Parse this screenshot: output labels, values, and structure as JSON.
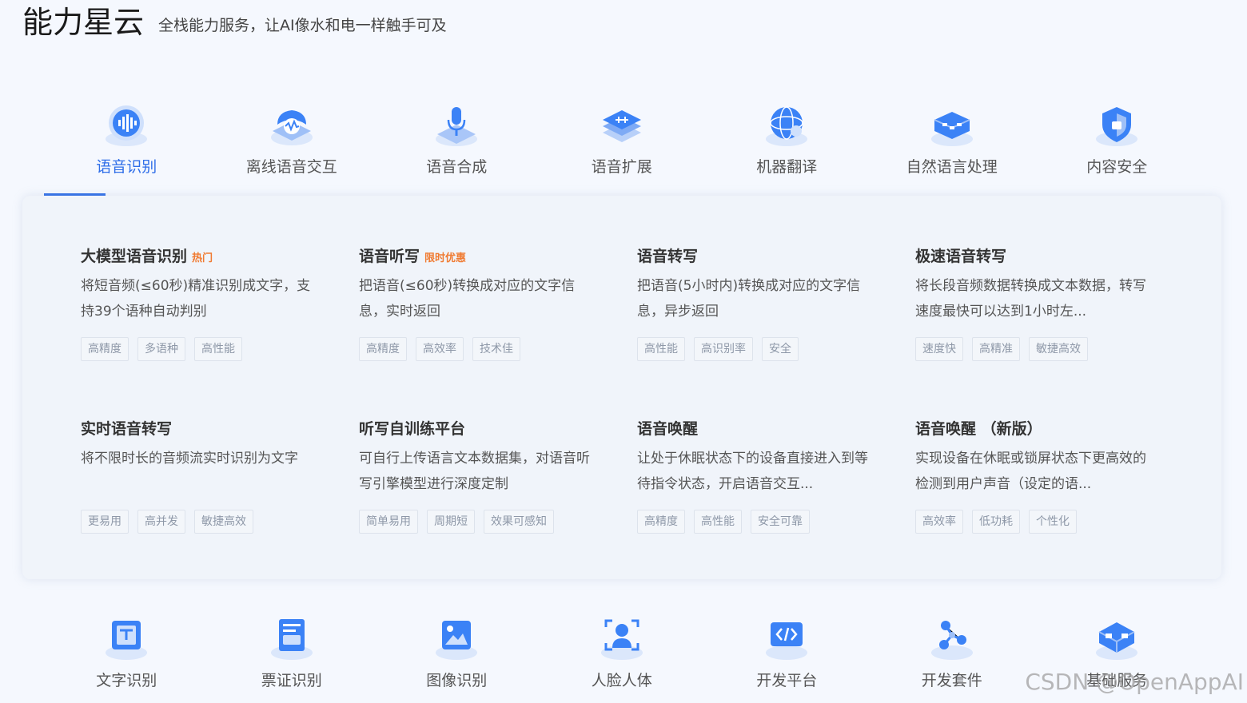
{
  "header": {
    "title": "能力星云",
    "subtitle": "全栈能力服务，让AI像水和电一样触手可及"
  },
  "tabs": [
    {
      "label": "语音识别",
      "icon": "voice-recognition-icon"
    },
    {
      "label": "离线语音交互",
      "icon": "offline-voice-icon"
    },
    {
      "label": "语音合成",
      "icon": "microphone-icon"
    },
    {
      "label": "语音扩展",
      "icon": "voice-extension-icon"
    },
    {
      "label": "机器翻译",
      "icon": "globe-icon"
    },
    {
      "label": "自然语言处理",
      "icon": "nlp-icon"
    },
    {
      "label": "内容安全",
      "icon": "shield-icon"
    }
  ],
  "active_tab": "语音识别",
  "cards": [
    {
      "title": "大模型语音识别",
      "badge": "热门",
      "desc": "将短音频(≤60秒)精准识别成文字，支持39个语种自动判别",
      "tags": [
        "高精度",
        "多语种",
        "高性能"
      ]
    },
    {
      "title": "语音听写",
      "badge": "限时优惠",
      "desc": "把语音(≤60秒)转换成对应的文字信息，实时返回",
      "tags": [
        "高精度",
        "高效率",
        "技术佳"
      ]
    },
    {
      "title": "语音转写",
      "badge": "",
      "desc": "把语音(5小时内)转换成对应的文字信息，异步返回",
      "tags": [
        "高性能",
        "高识别率",
        "安全"
      ]
    },
    {
      "title": "极速语音转写",
      "badge": "",
      "desc": "将长段音频数据转换成文本数据，转写速度最快可以达到1小时左...",
      "tags": [
        "速度快",
        "高精准",
        "敏捷高效"
      ]
    },
    {
      "title": "实时语音转写",
      "badge": "",
      "desc": "将不限时长的音频流实时识别为文字",
      "tags": [
        "更易用",
        "高并发",
        "敏捷高效"
      ]
    },
    {
      "title": "听写自训练平台",
      "badge": "",
      "desc": "可自行上传语言文本数据集，对语音听写引擎模型进行深度定制",
      "tags": [
        "简单易用",
        "周期短",
        "效果可感知"
      ]
    },
    {
      "title": "语音唤醒",
      "badge": "",
      "desc": "让处于休眠状态下的设备直接进入到等待指令状态，开启语音交互...",
      "tags": [
        "高精度",
        "高性能",
        "安全可靠"
      ]
    },
    {
      "title": "语音唤醒 （新版）",
      "badge": "",
      "desc": "实现设备在休眠或锁屏状态下更高效的检测到用户声音（设定的语...",
      "tags": [
        "高效率",
        "低功耗",
        "个性化"
      ]
    }
  ],
  "bottom_nav": [
    {
      "label": "文字识别",
      "icon": "ocr-icon"
    },
    {
      "label": "票证识别",
      "icon": "ticket-icon"
    },
    {
      "label": "图像识别",
      "icon": "image-icon"
    },
    {
      "label": "人脸人体",
      "icon": "face-icon"
    },
    {
      "label": "开发平台",
      "icon": "code-icon"
    },
    {
      "label": "开发套件",
      "icon": "kit-icon"
    },
    {
      "label": "基础服务",
      "icon": "base-service-icon"
    }
  ],
  "watermark": "CSDN @OpenAppAI",
  "colors": {
    "accent": "#2f6ee8",
    "badge": "#f07b32",
    "icon_blue": "#3b82f6"
  }
}
